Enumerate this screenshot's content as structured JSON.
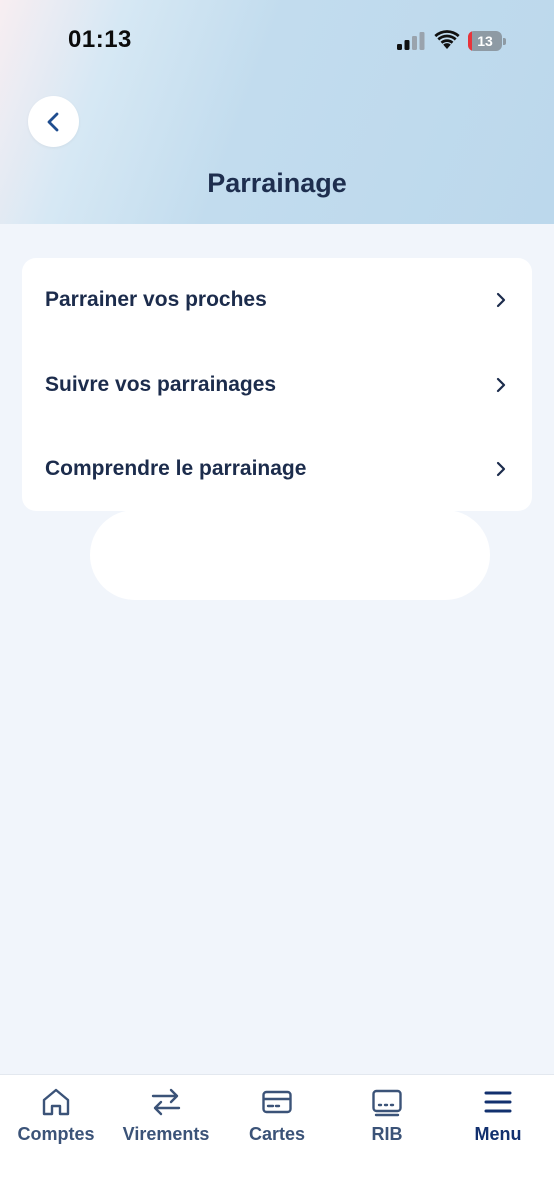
{
  "status_bar": {
    "time": "01:13",
    "battery_level": "13",
    "battery_fraction": 0.13
  },
  "header": {
    "title": "Parrainage",
    "back_icon": "chevron-left-icon"
  },
  "menu": {
    "items": [
      {
        "label": "Parrainer vos proches",
        "icon": "chevron-right-icon"
      },
      {
        "label": "Suivre vos parrainages",
        "icon": "chevron-right-icon"
      },
      {
        "label": "Comprendre le parrainage",
        "icon": "chevron-right-icon"
      }
    ]
  },
  "bottom_nav": {
    "items": [
      {
        "label": "Comptes",
        "icon": "home-icon",
        "active": false
      },
      {
        "label": "Virements",
        "icon": "transfer-arrows-icon",
        "active": false
      },
      {
        "label": "Cartes",
        "icon": "card-icon",
        "active": false
      },
      {
        "label": "RIB",
        "icon": "rib-icon",
        "active": false
      },
      {
        "label": "Menu",
        "icon": "hamburger-menu-icon",
        "active": true
      }
    ]
  },
  "colors": {
    "background": "#f1f5fb",
    "text_primary": "#1c2c4c",
    "nav_text": "#3b5378",
    "nav_active": "#12306e",
    "accent_blue": "#1f4d8f",
    "battery_low": "#e8333a"
  }
}
